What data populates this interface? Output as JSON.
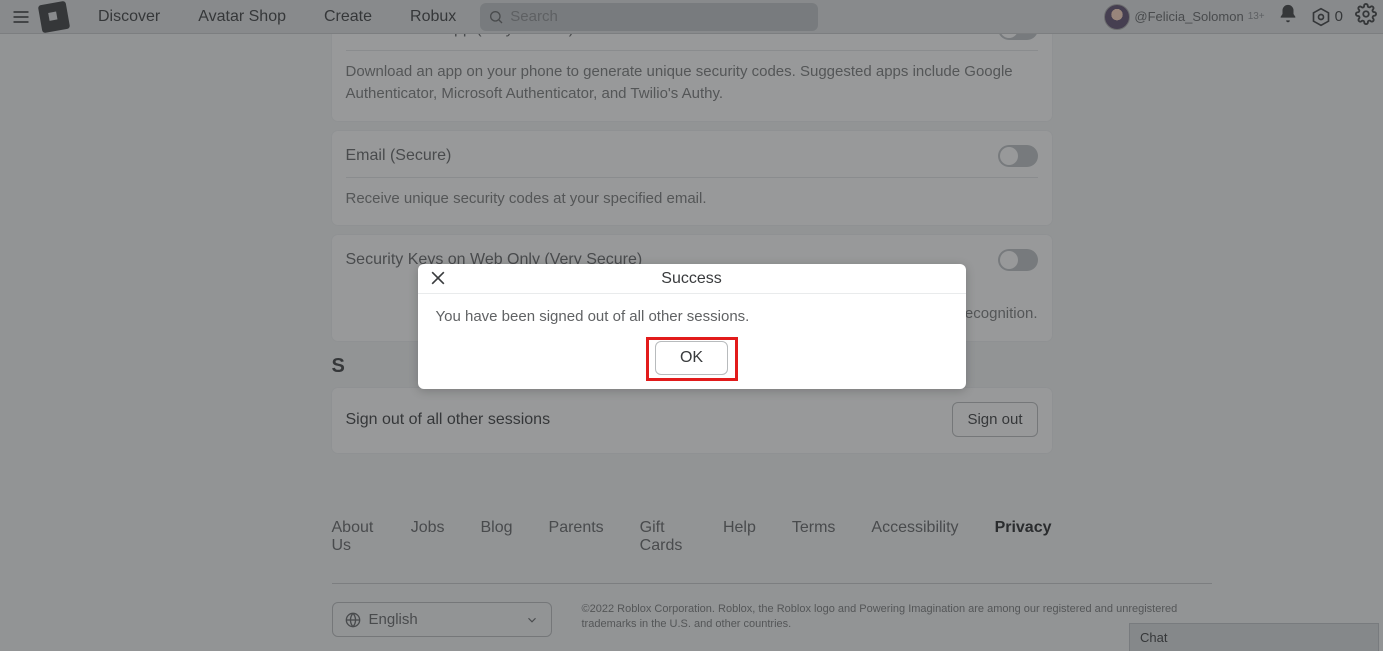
{
  "nav": {
    "items": [
      "Discover",
      "Avatar Shop",
      "Create",
      "Robux"
    ],
    "search_placeholder": "Search"
  },
  "user": {
    "handle": "@Felicia_Solomon",
    "age_badge": "13+",
    "robux": "0"
  },
  "settings": {
    "auth_app": {
      "title": "Authenticator App (Very Secure)",
      "desc": "Download an app on your phone to generate unique security codes. Suggested apps include Google Authenticator, Microsoft Authenticator, and Twilio's Authy."
    },
    "email": {
      "title": "Email (Secure)",
      "desc": "Receive unique security codes at your specified email."
    },
    "security_keys": {
      "title": "Security Keys on Web Only (Very Secure)",
      "desc_fragment": "recognition."
    },
    "secure_signout_heading": "S",
    "signout": {
      "label": "Sign out of all other sessions",
      "button": "Sign out"
    }
  },
  "footer": {
    "links": [
      "About Us",
      "Jobs",
      "Blog",
      "Parents",
      "Gift Cards",
      "Help",
      "Terms",
      "Accessibility",
      "Privacy"
    ],
    "language": "English",
    "copyright": "©2022 Roblox Corporation. Roblox, the Roblox logo and Powering Imagination are among our registered and unregistered trademarks in the U.S. and other countries."
  },
  "chat": {
    "label": "Chat"
  },
  "modal": {
    "title": "Success",
    "body": "You have been signed out of all other sessions.",
    "ok": "OK"
  }
}
